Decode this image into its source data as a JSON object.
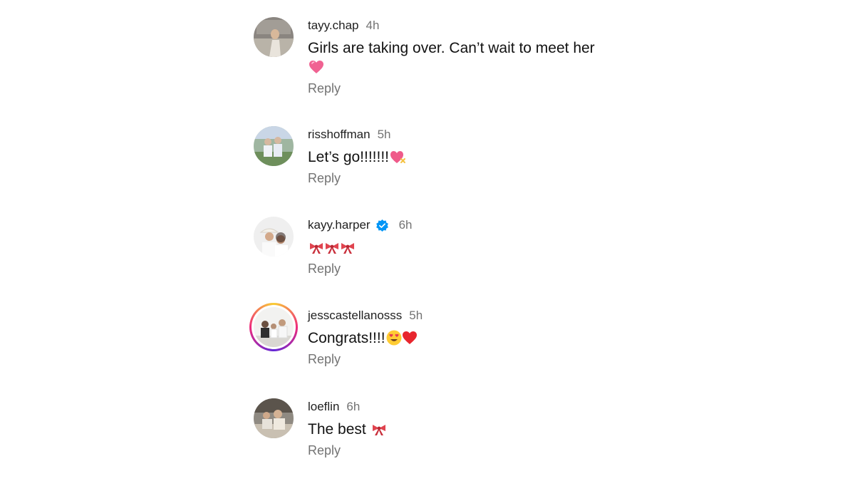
{
  "comments": [
    {
      "username": "tayy.chap",
      "time": "4h",
      "text": "Girls are taking over. Can’t wait to meet her",
      "emojis": [
        "pink-heart"
      ],
      "reply": "Reply",
      "verified": false
    },
    {
      "username": "risshoffman",
      "time": "5h",
      "text": "Let’s go!!!!!!!",
      "emojis": [
        "heart-with-ribbon"
      ],
      "reply": "Reply",
      "verified": false
    },
    {
      "username": "kayy.harper",
      "time": "6h",
      "text": "",
      "emojis": [
        "ribbon",
        "ribbon",
        "ribbon"
      ],
      "reply": "Reply",
      "verified": true
    },
    {
      "username": "jesscastellanosss",
      "time": "5h",
      "text": "Congrats!!!!",
      "emojis": [
        "smiling-face-with-heart-eyes",
        "red-heart"
      ],
      "reply": "Reply",
      "verified": false
    },
    {
      "username": "loeflin",
      "time": "6h",
      "text": "The best ",
      "emojis": [
        "ribbon"
      ],
      "reply": "Reply",
      "verified": false
    }
  ],
  "colors": {
    "text": "#121212",
    "muted": "#737373",
    "verified": "#0095f6"
  }
}
